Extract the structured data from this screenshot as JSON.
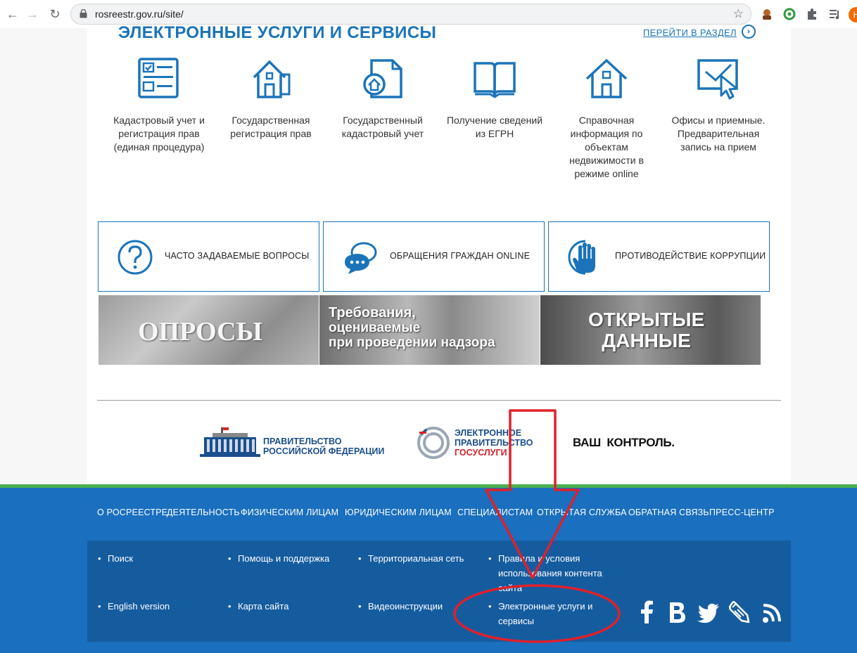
{
  "browser": {
    "url": "rosreestr.gov.ru/site/",
    "profile_initial": "Н"
  },
  "services_section": {
    "title": "ЭЛЕКТРОННЫЕ УСЛУГИ И СЕРВИСЫ",
    "link": "ПЕРЕЙТИ В РАЗДЕЛ",
    "items": [
      {
        "label": "Кадастровый учет и регистрация прав (единая процедура)",
        "icon": "form-document-icon"
      },
      {
        "label": "Государственная регистрация прав",
        "icon": "registration-houses-icon"
      },
      {
        "label": "Государственный кадастровый учет",
        "icon": "cadastre-folder-icon"
      },
      {
        "label": "Получение сведений из ЕГРН",
        "icon": "open-book-icon"
      },
      {
        "label": "Справочная информация по объектам недвижимости в режиме online",
        "icon": "house-icon"
      },
      {
        "label": "Офисы и приемные. Предварительная запись на прием",
        "icon": "monitor-cursor-icon"
      }
    ]
  },
  "tiles": [
    {
      "label": "ЧАСТО ЗАДАВАЕМЫЕ ВОПРОСЫ",
      "icon": "question-icon"
    },
    {
      "label": "ОБРАЩЕНИЯ ГРАЖДАН ONLINE",
      "icon": "chat-bubbles-icon"
    },
    {
      "label": "ПРОТИВОДЕЙСТВИЕ КОРРУПЦИИ",
      "icon": "stop-hand-icon"
    }
  ],
  "banners": {
    "surveys": "ОПРОСЫ",
    "requirements_line1": "Требования,",
    "requirements_line2": "оцениваемые",
    "requirements_line3": "при проведении надзора",
    "open_data_line1": "ОТКРЫТЫЕ",
    "open_data_line2": "ДАННЫЕ"
  },
  "partners": {
    "gov_line1": "ПРАВИТЕЛЬСТВО",
    "gov_line2": "РОССИЙСКОЙ ФЕДЕРАЦИИ",
    "egov_line1": "ЭЛЕКТРОННОЕ",
    "egov_line2": "ПРАВИТЕЛЬСТВО",
    "egov_line3": "ГОСУСЛУГИ",
    "control_a": "ВАШ",
    "control_b": "КОНТРОЛЬ."
  },
  "footer": {
    "menu": [
      "О РОСРЕЕСТРЕ",
      "ДЕЯТЕЛЬНОСТЬ",
      "ФИЗИЧЕСКИМ ЛИЦАМ",
      "ЮРИДИЧЕСКИМ ЛИЦАМ",
      "СПЕЦИАЛИСТАМ",
      "ОТКРЫТАЯ СЛУЖБА",
      "ОБРАТНАЯ СВЯЗЬ",
      "ПРЕСС-ЦЕНТР"
    ],
    "links": [
      "Поиск",
      "Помощь и поддержка",
      "Территориальная сеть",
      "Правила и условия использования контента сайта",
      "English version",
      "Карта сайта",
      "Видеоинструкции",
      "Электронные услуги и сервисы"
    ],
    "social": [
      "facebook-icon",
      "vk-icon",
      "twitter-icon",
      "blog-pencil-icon",
      "rss-icon"
    ]
  },
  "colors": {
    "brand_blue": "#1b74b9",
    "footer_blue": "#1a6fbe",
    "footer_box": "#155c9f",
    "footer_stripe": "#4caf50",
    "annotation_red": "#e0202a"
  }
}
